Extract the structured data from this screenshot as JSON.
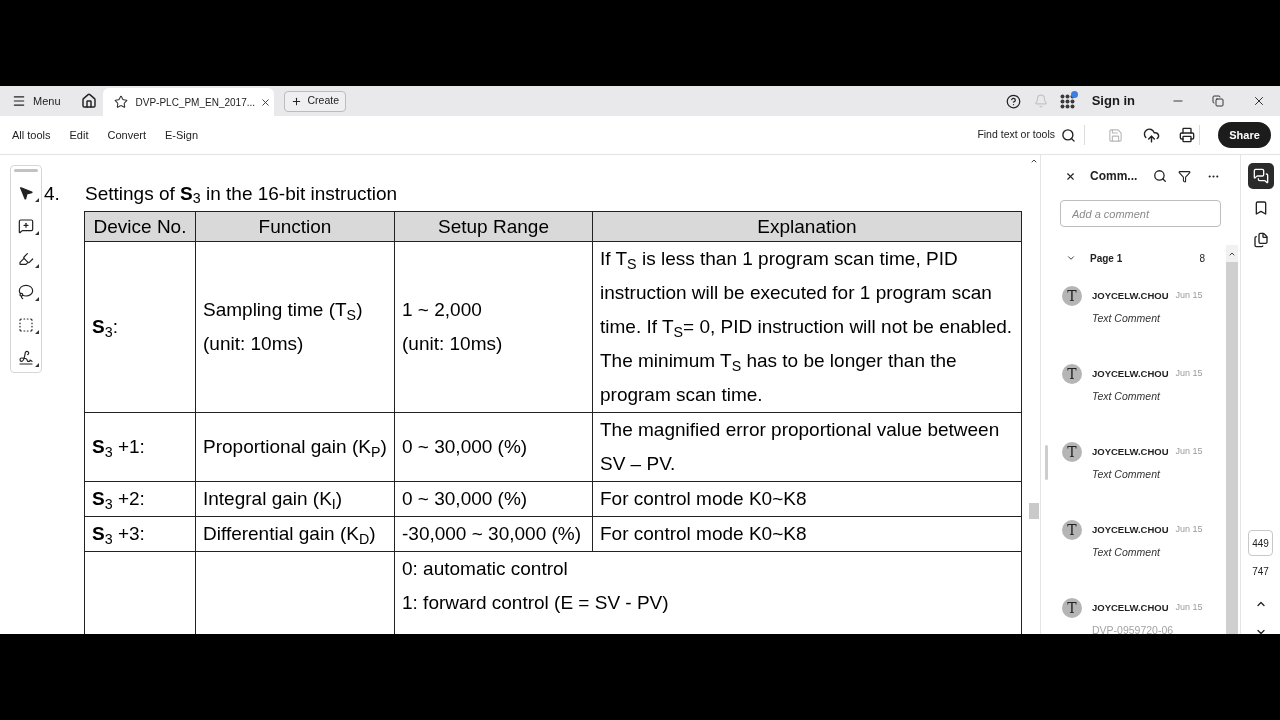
{
  "title_bar": {
    "menu_label": "Menu",
    "tabs": [
      {
        "title": "DVP-PLC_PM_EN_2017...",
        "selected": true
      }
    ],
    "create_label": "Create",
    "bell": {
      "disabled": true
    },
    "apps": {
      "badge": true
    },
    "sign_in_label": "Sign in"
  },
  "toolbar": {
    "items": [
      "All tools",
      "Edit",
      "Convert",
      "E-Sign"
    ],
    "search_label": "Find text or tools",
    "save": {
      "disabled": true
    },
    "share_label": "Share"
  },
  "document": {
    "section_number": "4.",
    "heading": "Settings of **S**$_{3}$ in the 16-bit instruction",
    "table": {
      "columns": [
        "Device No.",
        "Function",
        "Setup Range",
        "Explanation"
      ],
      "rows": [
        {
          "device": "**S**$_{3}$:",
          "function": [
            "Sampling time (T$_{S}$)",
            "(unit: 10ms)"
          ],
          "range": [
            "1 ~ 2,000",
            "(unit: 10ms)"
          ],
          "explanation": "If T$_{S}$ is less than 1 program scan time, PID instruction will be executed for 1 program scan time. If T$_{S}$= 0, PID instruction will not be enabled. The minimum T$_{S}$ has to be longer than the program scan time."
        },
        {
          "device": "**S**$_{3}$ +1:",
          "function": [
            "Proportional gain (K$_{P}$)"
          ],
          "range": [
            "0 ~ 30,000 (%)"
          ],
          "explanation": "The magnified error proportional value between SV – PV."
        },
        {
          "device": "**S**$_{3}$ +2:",
          "function": [
            "Integral gain (K$_{I}$)"
          ],
          "range": [
            "0 ~ 30,000 (%)"
          ],
          "explanation": "For control mode K0~K8"
        },
        {
          "device": "**S**$_{3}$ +3:",
          "function": [
            "Differential gain (K$_{D}$)"
          ],
          "range": [
            "-30,000 ~ 30,000 (%)"
          ],
          "explanation": "For control mode K0~K8"
        },
        {
          "range": [
            "0: automatic control",
            "1: forward control (E = SV - PV)"
          ]
        }
      ]
    }
  },
  "comments_panel": {
    "title": "Comm...",
    "add_placeholder": "Add a comment",
    "groups": [
      {
        "label": "Page 1",
        "count": "8",
        "expanded": true,
        "comments": [
          {
            "avatar": "T",
            "author": "JOYCELW.CHOU",
            "date": "Jun 15",
            "body": "Text Comment",
            "kind": "type_label"
          },
          {
            "avatar": "T",
            "author": "JOYCELW.CHOU",
            "date": "Jun 15",
            "body": "Text Comment",
            "kind": "type_label"
          },
          {
            "avatar": "T",
            "author": "JOYCELW.CHOU",
            "date": "Jun 15",
            "body": "Text Comment",
            "kind": "type_label"
          },
          {
            "avatar": "T",
            "author": "JOYCELW.CHOU",
            "date": "Jun 15",
            "body": "Text Comment",
            "kind": "type_label"
          },
          {
            "avatar": "T",
            "author": "JOYCELW.CHOU",
            "date": "Jun 15",
            "body": "DVP-0959720-06",
            "kind": "text"
          }
        ]
      }
    ]
  },
  "right_rail": {
    "panels": [
      {
        "selected": true
      },
      {
        "selected": false
      },
      {
        "selected": false
      }
    ],
    "page_nav": {
      "current": "449",
      "total": "747"
    }
  }
}
